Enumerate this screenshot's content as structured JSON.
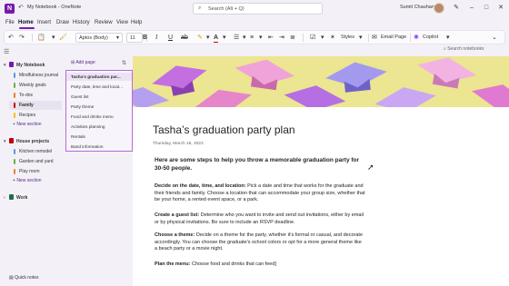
{
  "app": {
    "window_title": "My Notebook - OneNote",
    "search_placeholder": "Search (Alt + Q)",
    "user_name": "Sumit Chauhan"
  },
  "menu": [
    "File",
    "Home",
    "Insert",
    "Draw",
    "History",
    "Review",
    "View",
    "Help"
  ],
  "ribbon": {
    "font_name": "Aptos (Body)",
    "font_size": "11",
    "styles_label": "Styles",
    "email_page_label": "Email Page",
    "copilot_label": "Copilot"
  },
  "search_notebooks": "Search notebooks",
  "notebooks": [
    {
      "name": "My Notebook",
      "color": "#7719aa",
      "sections": [
        {
          "label": "Mindfulness journal",
          "color": "#5b9bd5"
        },
        {
          "label": "Weekly goals",
          "color": "#70ad47"
        },
        {
          "label": "To-dos",
          "color": "#ed7d31"
        },
        {
          "label": "Family",
          "color": "#c00000",
          "active": true
        },
        {
          "label": "Recipes",
          "color": "#ffc000"
        }
      ],
      "new_section": "New section"
    },
    {
      "name": "House projects",
      "color": "#c00000",
      "sections": [
        {
          "label": "Kitchen remodel",
          "color": "#5b9bd5"
        },
        {
          "label": "Garden and yard",
          "color": "#70ad47"
        },
        {
          "label": "Play room",
          "color": "#ed7d31"
        }
      ],
      "new_section": "New section"
    },
    {
      "name": "Work",
      "color": "#1e7145"
    }
  ],
  "quick_notes": "Quick notes",
  "add_page": "Add page",
  "pages": [
    "Tasha's graduation par...",
    "Party date, time and locat...",
    "Guest list",
    "Party theme",
    "Food and drinks menu",
    "Activities planning",
    "Rentals",
    "Band information"
  ],
  "page": {
    "title": "Tasha’s graduation party plan",
    "date": "Thursday, March 16, 2023",
    "intro": "Here are some steps to help you throw a memorable graduation party for 30-50 people.",
    "steps": [
      {
        "lead": "Decide on the date, time, and location:",
        "text": " Pick a date and time that works for the graduate and their friends and family. Choose a location that can accommodate your group size, whether that be your home, a rented event space, or a park."
      },
      {
        "lead": "Create a guest list:",
        "text": " Determine who you want to invite and send out invitations, either by email or by physical invitations. Be sure to include an RSVP deadline."
      },
      {
        "lead": "Choose a theme:",
        "text": " Decide on a theme for the party, whether it's formal or casual, and decorate accordingly. You can choose the graduate's school colors or opt for a more general theme like a beach party or a movie night."
      },
      {
        "lead": "Plan the menu:",
        "text": " Choose food and drinks that can feed]"
      }
    ]
  }
}
